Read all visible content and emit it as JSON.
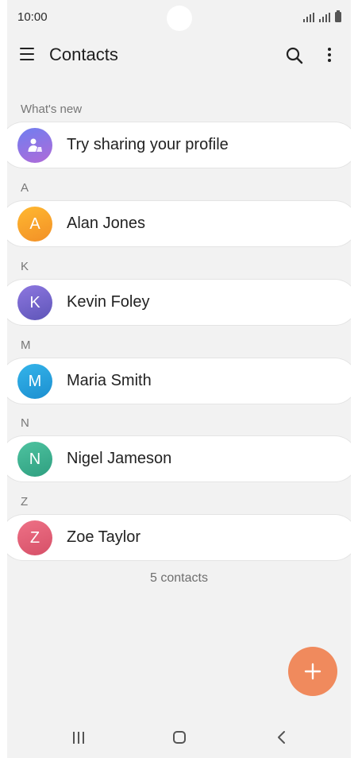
{
  "status_bar": {
    "time": "10:00"
  },
  "app_bar": {
    "title": "Contacts"
  },
  "whats_new": {
    "header": "What's new",
    "item_label": "Try sharing your profile"
  },
  "sections": [
    {
      "letter": "A",
      "contacts": [
        {
          "name": "Alan Jones",
          "initial": "A",
          "color": "#f8a030"
        }
      ]
    },
    {
      "letter": "K",
      "contacts": [
        {
          "name": "Kevin Foley",
          "initial": "K",
          "color": "#7a63c8"
        }
      ]
    },
    {
      "letter": "M",
      "contacts": [
        {
          "name": "Maria Smith",
          "initial": "M",
          "color": "#2aa0da"
        }
      ]
    },
    {
      "letter": "N",
      "contacts": [
        {
          "name": "Nigel Jameson",
          "initial": "N",
          "color": "#3eb38f"
        }
      ]
    },
    {
      "letter": "Z",
      "contacts": [
        {
          "name": "Zoe Taylor",
          "initial": "Z",
          "color": "#e2637a"
        }
      ]
    }
  ],
  "contact_count": "5 contacts",
  "colors": {
    "fab": "#f08a5d",
    "profile_avatar": "#8a6ee0",
    "background": "#f2f2f2"
  }
}
